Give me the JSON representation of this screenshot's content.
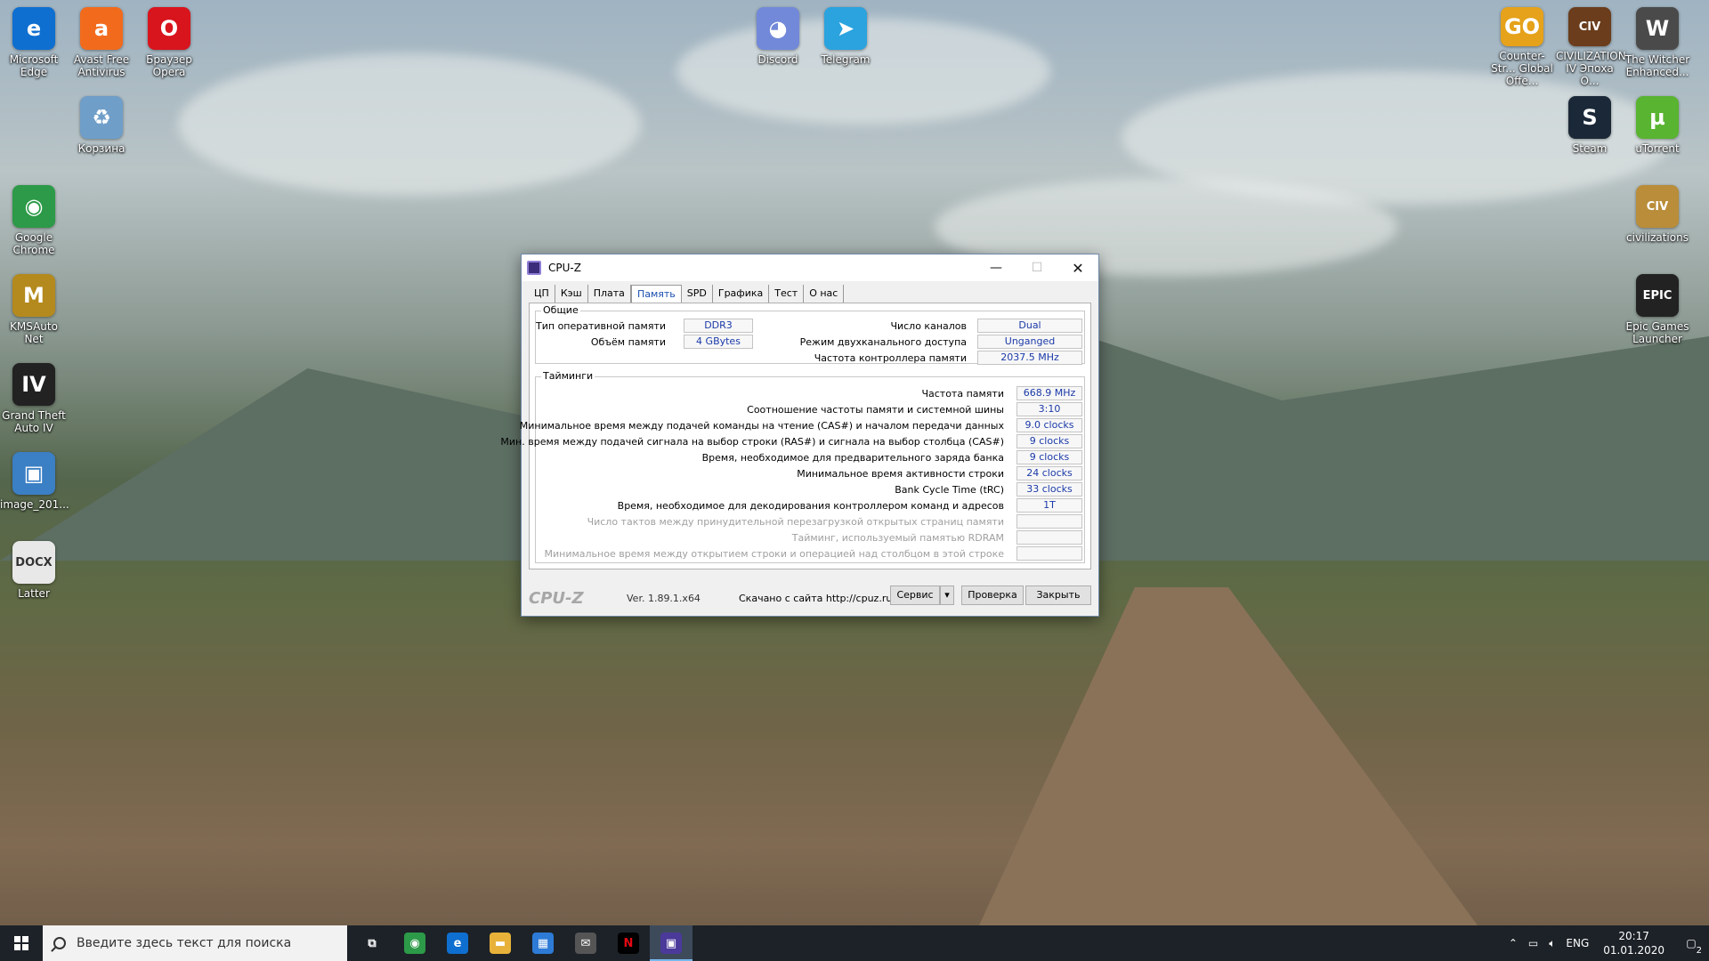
{
  "desktop": {
    "icons": [
      {
        "label": "Microsoft Edge",
        "glyph": "e",
        "color": "#0f6fd0"
      },
      {
        "label": "Avast Free Antivirus",
        "glyph": "a",
        "color": "#f26b1d"
      },
      {
        "label": "Браузер Opera",
        "glyph": "O",
        "color": "#d8141d"
      },
      {
        "label": "Корзина",
        "glyph": "♻",
        "color": "#6f9ec9"
      },
      {
        "label": "Google Chrome",
        "glyph": "◉",
        "color": "#2c9a48"
      },
      {
        "label": "KMSAuto Net",
        "glyph": "M",
        "color": "#b48a1e"
      },
      {
        "label": "Grand Theft Auto IV",
        "glyph": "IV",
        "color": "#222222"
      },
      {
        "label": "image_201...",
        "glyph": "▣",
        "color": "#3b7fc4"
      },
      {
        "label": "Latter",
        "glyph": "DOCX",
        "color": "#e8e8e8"
      },
      {
        "label": "Discord",
        "glyph": "◕",
        "color": "#7289da"
      },
      {
        "label": "Telegram",
        "glyph": "➤",
        "color": "#2aa3df"
      },
      {
        "label": "Counter-Str... Global Offe...",
        "glyph": "GO",
        "color": "#e5a21a"
      },
      {
        "label": "CIVILIZATION IV Эпоха О...",
        "glyph": "CIV",
        "color": "#6b3d1c"
      },
      {
        "label": "The Witcher Enhanced...",
        "glyph": "W",
        "color": "#4a4a4a"
      },
      {
        "label": "Steam",
        "glyph": "S",
        "color": "#1b2838"
      },
      {
        "label": "uTorrent",
        "glyph": "µ",
        "color": "#59b431"
      },
      {
        "label": "civilizations",
        "glyph": "CIV",
        "color": "#b98d3a"
      },
      {
        "label": "Epic Games Launcher",
        "glyph": "EPIC",
        "color": "#222222"
      }
    ]
  },
  "window": {
    "title": "CPU-Z",
    "tabs": [
      "ЦП",
      "Кэш",
      "Плата",
      "Память",
      "SPD",
      "Графика",
      "Тест",
      "О нас"
    ],
    "active_tab": "Память",
    "general": {
      "title": "Общие",
      "type_label": "Тип оперативной памяти",
      "type_value": "DDR3",
      "size_label": "Объём памяти",
      "size_value": "4 GBytes",
      "channels_label": "Число каналов",
      "channels_value": "Dual",
      "dc_mode_label": "Режим двухканального доступа",
      "dc_mode_value": "Unganged",
      "nb_freq_label": "Частота контроллера памяти",
      "nb_freq_value": "2037.5 MHz"
    },
    "timings": {
      "title": "Тайминги",
      "rows": [
        {
          "label": "Частота памяти",
          "value": "668.9 MHz",
          "dim": false
        },
        {
          "label": "Соотношение частоты памяти и системной шины",
          "value": "3:10",
          "dim": false
        },
        {
          "label": "Минимальное время между подачей команды на чтение (CAS#) и началом передачи данных",
          "value": "9.0 clocks",
          "dim": false
        },
        {
          "label": "Мин. время между подачей сигнала на выбор строки (RAS#) и сигнала на выбор столбца (CAS#)",
          "value": "9 clocks",
          "dim": false
        },
        {
          "label": "Время, необходимое для предварительного заряда банка",
          "value": "9 clocks",
          "dim": false
        },
        {
          "label": "Минимальное время активности строки",
          "value": "24 clocks",
          "dim": false
        },
        {
          "label": "Bank Cycle Time (tRC)",
          "value": "33 clocks",
          "dim": false
        },
        {
          "label": "Время, необходимое для декодирования контроллером команд и адресов",
          "value": "1T",
          "dim": false
        },
        {
          "label": "Число тактов между принудительной перезагрузкой открытых страниц памяти",
          "value": "",
          "dim": true
        },
        {
          "label": "Тайминг, используемый памятью RDRAM",
          "value": "",
          "dim": true
        },
        {
          "label": "Минимальное время между открытием строки и операцией над столбцом в этой строке",
          "value": "",
          "dim": true
        }
      ]
    },
    "bottom": {
      "brand": "CPU-Z",
      "version": "Ver. 1.89.1.x64",
      "download": "Скачано с сайта http://cpuz.ru",
      "service_button": "Сервис",
      "validate_button": "Проверка",
      "close_button": "Закрыть"
    }
  },
  "taskbar": {
    "search_placeholder": "Введите здесь текст для поиска",
    "apps": [
      {
        "name": "task-view",
        "glyph": "⧉",
        "color": "transparent"
      },
      {
        "name": "chrome",
        "glyph": "◉",
        "color": "#2c9a48"
      },
      {
        "name": "edge",
        "glyph": "e",
        "color": "#0f6fd0"
      },
      {
        "name": "file-explorer",
        "glyph": "▬",
        "color": "#e8b23a"
      },
      {
        "name": "store",
        "glyph": "▦",
        "color": "#2d7bd6"
      },
      {
        "name": "mail",
        "glyph": "✉",
        "color": "#555555"
      },
      {
        "name": "netflix",
        "glyph": "N",
        "color": "#000000"
      },
      {
        "name": "cpu-z",
        "glyph": "▣",
        "color": "#4b3a9a"
      }
    ],
    "language": "ENG",
    "time": "20:17",
    "date": "01.01.2020",
    "notification_count": "2"
  }
}
